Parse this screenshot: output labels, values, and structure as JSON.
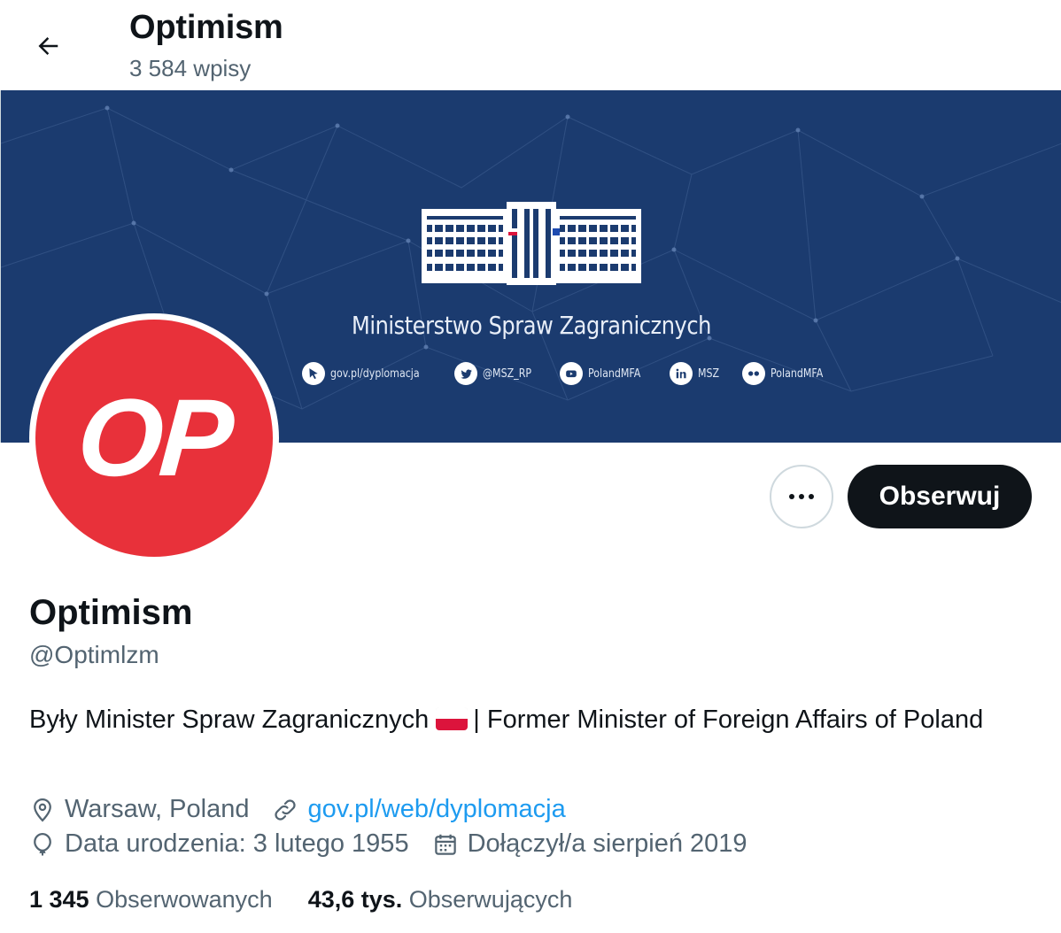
{
  "header": {
    "title": "Optimism",
    "post_count": "3 584 wpisy"
  },
  "banner": {
    "ministry_name": "Ministerstwo Spraw Zagranicznych",
    "socials": [
      {
        "icon": "cursor-icon",
        "label": "gov.pl/dyplomacja"
      },
      {
        "icon": "twitter-icon",
        "label": "@MSZ_RP"
      },
      {
        "icon": "youtube-icon",
        "label": "PolandMFA"
      },
      {
        "icon": "linkedin-icon",
        "label": "MSZ"
      },
      {
        "icon": "flickr-icon",
        "label": "PolandMFA"
      }
    ],
    "background_color": "#1b3b6f"
  },
  "avatar": {
    "text": "OP",
    "color": "#e8313a"
  },
  "actions": {
    "follow_label": "Obserwuj"
  },
  "profile": {
    "name": "Optimism",
    "handle": "@Optimlzm",
    "bio_part1": "Były Minister Spraw Zagranicznych",
    "bio_part2": "| Former Minister of Foreign Affairs of Poland",
    "location": "Warsaw, Poland",
    "website": "gov.pl/web/dyplomacja",
    "birthday": "Data urodzenia: 3 lutego 1955",
    "joined": "Dołączył/a sierpień 2019"
  },
  "stats": {
    "following_count": "1 345",
    "following_label": "Obserwowanych",
    "followers_count": "43,6 tys.",
    "followers_label": "Obserwujących"
  },
  "colors": {
    "text": "#0f1419",
    "muted": "#536471",
    "link": "#1d9bf0"
  }
}
